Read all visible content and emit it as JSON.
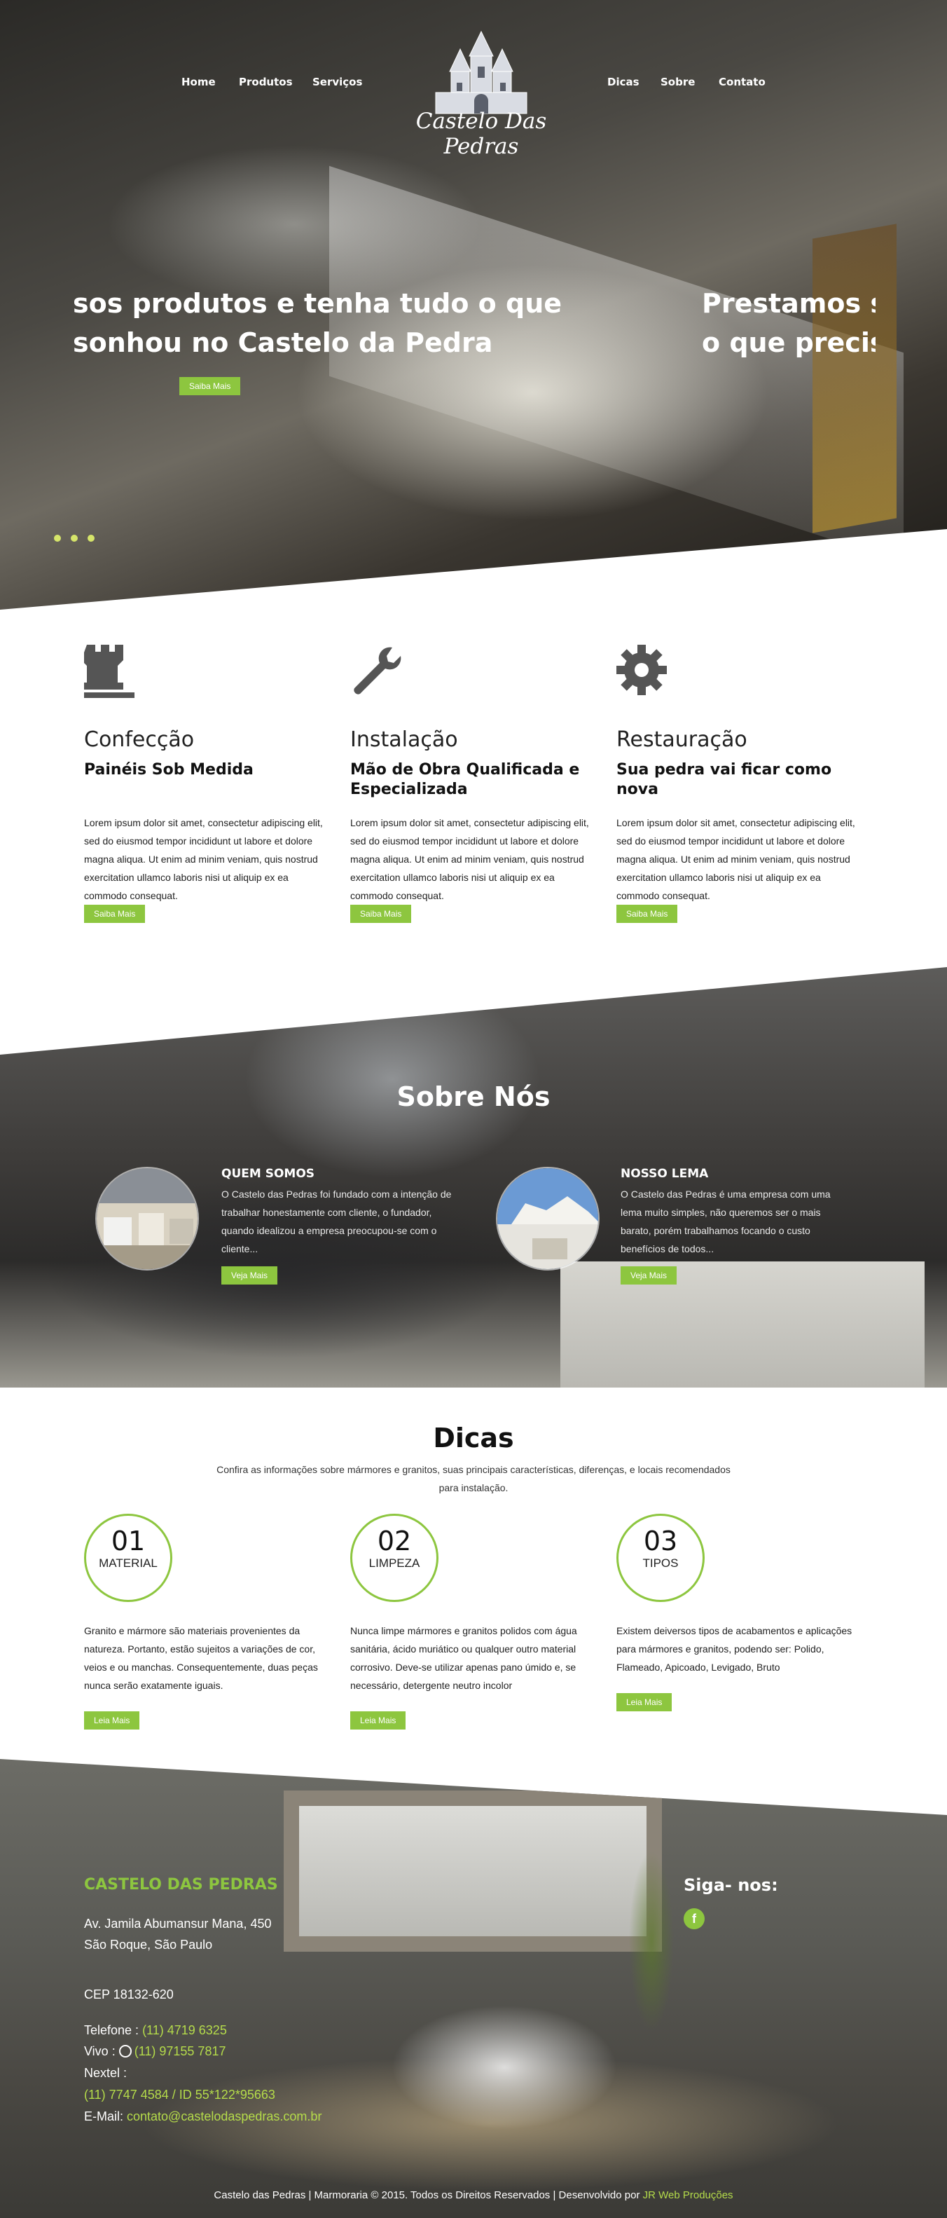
{
  "nav": {
    "items": [
      "Home",
      "Produtos",
      "Serviços",
      "Dicas",
      "Sobre",
      "Contato"
    ],
    "logo_text": "Castelo Das Pedras"
  },
  "hero": {
    "slide1": {
      "line1": "sos produtos e tenha tudo o que",
      "line2": "sonhou no Castelo da Pedra",
      "button": "Saiba Mais"
    },
    "slide2": {
      "line1": "Prestamos se",
      "line2": "o que precis"
    },
    "dots": 3
  },
  "services": [
    {
      "icon": "rook-icon",
      "title": "Confecção",
      "subtitle": "Painéis Sob Medida",
      "text": "Lorem ipsum dolor sit amet, consectetur adipiscing elit, sed do eiusmod tempor incididunt ut labore et dolore magna aliqua. Ut enim ad minim veniam, quis nostrud exercitation ullamco laboris nisi ut aliquip ex ea commodo consequat.",
      "button": "Saiba Mais"
    },
    {
      "icon": "wrench-icon",
      "title": "Instalação",
      "subtitle": "Mão de Obra Qualificada e Especializada",
      "text": "Lorem ipsum dolor sit amet, consectetur adipiscing elit, sed do eiusmod tempor incididunt ut labore et dolore magna aliqua. Ut enim ad minim veniam, quis nostrud exercitation ullamco laboris nisi ut aliquip ex ea commodo consequat.",
      "button": "Saiba Mais"
    },
    {
      "icon": "gear-icon",
      "title": "Restauração",
      "subtitle": "Sua pedra vai ficar como nova",
      "text": "Lorem ipsum dolor sit amet, consectetur adipiscing elit, sed do eiusmod tempor incididunt ut labore et dolore magna aliqua. Ut enim ad minim veniam, quis nostrud exercitation ullamco laboris nisi ut aliquip ex ea commodo consequat.",
      "button": "Saiba Mais"
    }
  ],
  "about": {
    "title": "Sobre Nós",
    "cols": [
      {
        "heading": "QUEM SOMOS",
        "text": "O Castelo das Pedras foi fundado com a intenção de trabalhar honestamente com cliente, o fundador, quando idealizou a empresa preocupou-se com o cliente...",
        "button": "Veja Mais"
      },
      {
        "heading": "NOSSO LEMA",
        "text": "O Castelo das Pedras é uma empresa com uma lema muito simples, não queremos ser o mais barato, porém trabalhamos focando o custo benefícios de todos...",
        "button": "Veja Mais"
      }
    ]
  },
  "tips": {
    "title": "Dicas",
    "subtitle": "Confira as informações sobre mármores e granitos, suas principais características, diferenças, e locais recomendados para instalação.",
    "items": [
      {
        "num": "01",
        "label": "MATERIAL",
        "text": "Granito e mármore são materiais provenientes da natureza. Portanto, estão sujeitos a variações de cor, veios e ou manchas. Consequentemente, duas peças nunca serão exatamente iguais.",
        "button": "Leia Mais"
      },
      {
        "num": "02",
        "label": "LIMPEZA",
        "text": "Nunca limpe mármores e granitos polidos com água sanitária, ácido muriático ou qualquer outro material corrosivo. Deve-se utilizar apenas pano úmido e, se necessário, detergente neutro incolor",
        "button": "Leia Mais"
      },
      {
        "num": "03",
        "label": "TIPOS",
        "text": "Existem deiversos tipos de acabamentos e aplicações para mármores e granitos, podendo ser: Polido, Flameado, Apicoado, Levigado, Bruto",
        "button": "Leia Mais"
      }
    ]
  },
  "footer": {
    "brand": "CASTELO DAS PEDRAS",
    "address1": "Av. Jamila Abumansur Mana, 450",
    "address2": "São Roque, São Paulo",
    "cep": "CEP 18132-620",
    "tel_label": "Telefone : ",
    "tel": "(11) 4719 6325",
    "vivo_label": "Vivo : ",
    "vivo": "(11) 97155 7817",
    "nextel_label": "Nextel :",
    "nextel": "(11) 7747 4584 / ID 55*122*95663",
    "email_label": "E-Mail: ",
    "email": "contato@castelodaspedras.com.br",
    "follow": "Siga- nos:",
    "copyright": "Castelo das Pedras | Marmoraria © 2015. Todos os Direitos Reservados | Desenvolvido por ",
    "dev": "JR Web Produções"
  },
  "colors": {
    "accent": "#8dc63f",
    "dark_icon": "#555555"
  }
}
